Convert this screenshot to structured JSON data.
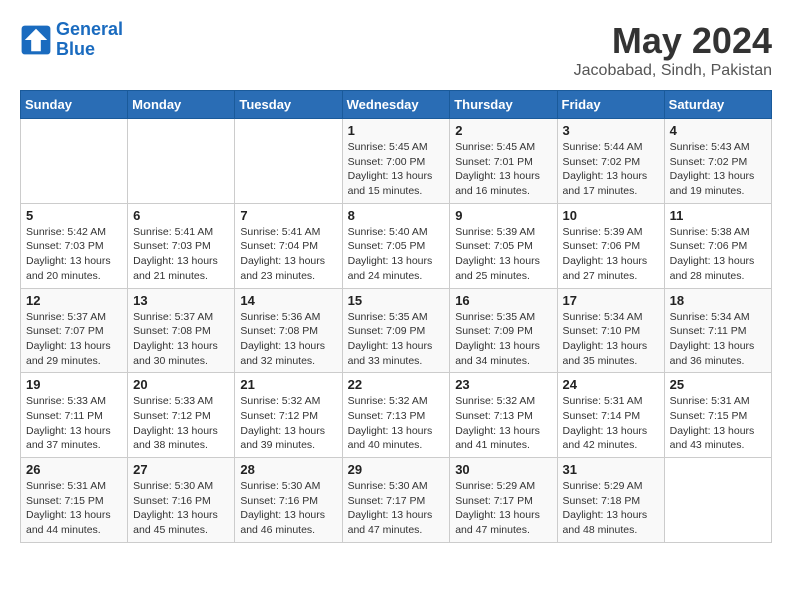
{
  "header": {
    "logo_line1": "General",
    "logo_line2": "Blue",
    "month": "May 2024",
    "location": "Jacobabad, Sindh, Pakistan"
  },
  "weekdays": [
    "Sunday",
    "Monday",
    "Tuesday",
    "Wednesday",
    "Thursday",
    "Friday",
    "Saturday"
  ],
  "weeks": [
    [
      {
        "day": "",
        "info": ""
      },
      {
        "day": "",
        "info": ""
      },
      {
        "day": "",
        "info": ""
      },
      {
        "day": "1",
        "info": "Sunrise: 5:45 AM\nSunset: 7:00 PM\nDaylight: 13 hours\nand 15 minutes."
      },
      {
        "day": "2",
        "info": "Sunrise: 5:45 AM\nSunset: 7:01 PM\nDaylight: 13 hours\nand 16 minutes."
      },
      {
        "day": "3",
        "info": "Sunrise: 5:44 AM\nSunset: 7:02 PM\nDaylight: 13 hours\nand 17 minutes."
      },
      {
        "day": "4",
        "info": "Sunrise: 5:43 AM\nSunset: 7:02 PM\nDaylight: 13 hours\nand 19 minutes."
      }
    ],
    [
      {
        "day": "5",
        "info": "Sunrise: 5:42 AM\nSunset: 7:03 PM\nDaylight: 13 hours\nand 20 minutes."
      },
      {
        "day": "6",
        "info": "Sunrise: 5:41 AM\nSunset: 7:03 PM\nDaylight: 13 hours\nand 21 minutes."
      },
      {
        "day": "7",
        "info": "Sunrise: 5:41 AM\nSunset: 7:04 PM\nDaylight: 13 hours\nand 23 minutes."
      },
      {
        "day": "8",
        "info": "Sunrise: 5:40 AM\nSunset: 7:05 PM\nDaylight: 13 hours\nand 24 minutes."
      },
      {
        "day": "9",
        "info": "Sunrise: 5:39 AM\nSunset: 7:05 PM\nDaylight: 13 hours\nand 25 minutes."
      },
      {
        "day": "10",
        "info": "Sunrise: 5:39 AM\nSunset: 7:06 PM\nDaylight: 13 hours\nand 27 minutes."
      },
      {
        "day": "11",
        "info": "Sunrise: 5:38 AM\nSunset: 7:06 PM\nDaylight: 13 hours\nand 28 minutes."
      }
    ],
    [
      {
        "day": "12",
        "info": "Sunrise: 5:37 AM\nSunset: 7:07 PM\nDaylight: 13 hours\nand 29 minutes."
      },
      {
        "day": "13",
        "info": "Sunrise: 5:37 AM\nSunset: 7:08 PM\nDaylight: 13 hours\nand 30 minutes."
      },
      {
        "day": "14",
        "info": "Sunrise: 5:36 AM\nSunset: 7:08 PM\nDaylight: 13 hours\nand 32 minutes."
      },
      {
        "day": "15",
        "info": "Sunrise: 5:35 AM\nSunset: 7:09 PM\nDaylight: 13 hours\nand 33 minutes."
      },
      {
        "day": "16",
        "info": "Sunrise: 5:35 AM\nSunset: 7:09 PM\nDaylight: 13 hours\nand 34 minutes."
      },
      {
        "day": "17",
        "info": "Sunrise: 5:34 AM\nSunset: 7:10 PM\nDaylight: 13 hours\nand 35 minutes."
      },
      {
        "day": "18",
        "info": "Sunrise: 5:34 AM\nSunset: 7:11 PM\nDaylight: 13 hours\nand 36 minutes."
      }
    ],
    [
      {
        "day": "19",
        "info": "Sunrise: 5:33 AM\nSunset: 7:11 PM\nDaylight: 13 hours\nand 37 minutes."
      },
      {
        "day": "20",
        "info": "Sunrise: 5:33 AM\nSunset: 7:12 PM\nDaylight: 13 hours\nand 38 minutes."
      },
      {
        "day": "21",
        "info": "Sunrise: 5:32 AM\nSunset: 7:12 PM\nDaylight: 13 hours\nand 39 minutes."
      },
      {
        "day": "22",
        "info": "Sunrise: 5:32 AM\nSunset: 7:13 PM\nDaylight: 13 hours\nand 40 minutes."
      },
      {
        "day": "23",
        "info": "Sunrise: 5:32 AM\nSunset: 7:13 PM\nDaylight: 13 hours\nand 41 minutes."
      },
      {
        "day": "24",
        "info": "Sunrise: 5:31 AM\nSunset: 7:14 PM\nDaylight: 13 hours\nand 42 minutes."
      },
      {
        "day": "25",
        "info": "Sunrise: 5:31 AM\nSunset: 7:15 PM\nDaylight: 13 hours\nand 43 minutes."
      }
    ],
    [
      {
        "day": "26",
        "info": "Sunrise: 5:31 AM\nSunset: 7:15 PM\nDaylight: 13 hours\nand 44 minutes."
      },
      {
        "day": "27",
        "info": "Sunrise: 5:30 AM\nSunset: 7:16 PM\nDaylight: 13 hours\nand 45 minutes."
      },
      {
        "day": "28",
        "info": "Sunrise: 5:30 AM\nSunset: 7:16 PM\nDaylight: 13 hours\nand 46 minutes."
      },
      {
        "day": "29",
        "info": "Sunrise: 5:30 AM\nSunset: 7:17 PM\nDaylight: 13 hours\nand 47 minutes."
      },
      {
        "day": "30",
        "info": "Sunrise: 5:29 AM\nSunset: 7:17 PM\nDaylight: 13 hours\nand 47 minutes."
      },
      {
        "day": "31",
        "info": "Sunrise: 5:29 AM\nSunset: 7:18 PM\nDaylight: 13 hours\nand 48 minutes."
      },
      {
        "day": "",
        "info": ""
      }
    ]
  ]
}
